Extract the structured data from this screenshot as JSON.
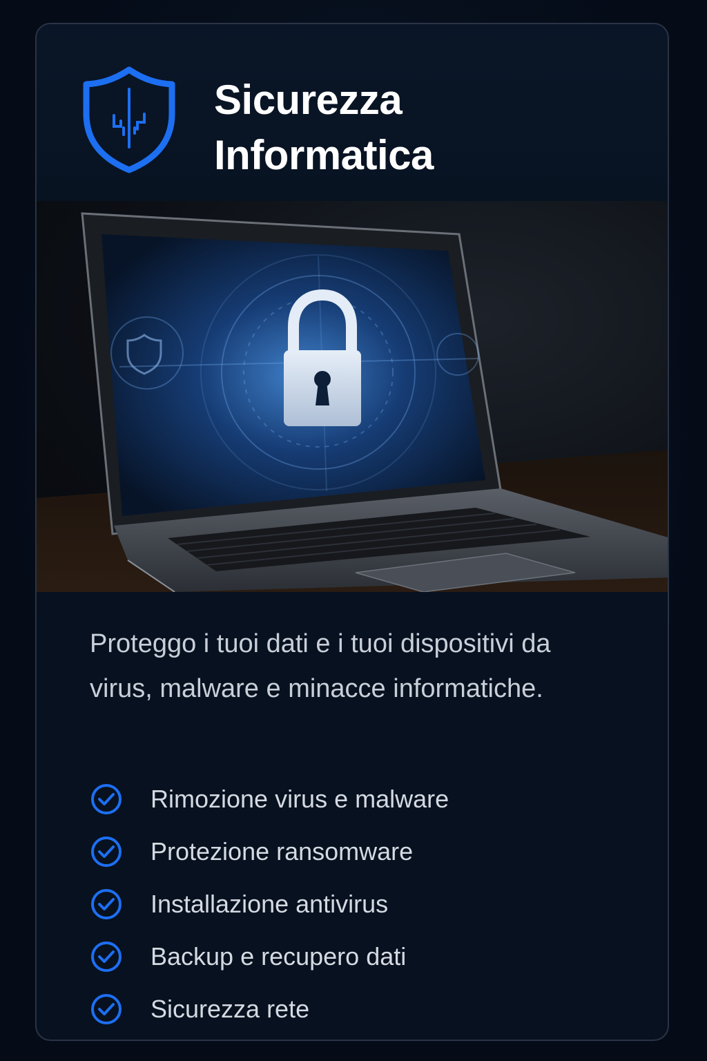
{
  "header": {
    "title_line1": "Sicurezza",
    "title_line2": "Informatica",
    "logo_icon": "shield-icon"
  },
  "hero": {
    "image": "laptop-padlock-illustration",
    "icons": [
      "laptop-icon",
      "padlock-icon"
    ]
  },
  "description": "Proteggo i tuoi dati e i tuoi dispositivi da virus, malware e minacce informatiche.",
  "features": [
    {
      "label": "Rimozione virus e malware",
      "icon": "check-circle-icon"
    },
    {
      "label": "Protezione ransomware",
      "icon": "check-circle-icon"
    },
    {
      "label": "Installazione antivirus",
      "icon": "check-circle-icon"
    },
    {
      "label": "Backup e recupero dati",
      "icon": "check-circle-icon"
    },
    {
      "label": "Sicurezza rete",
      "icon": "check-circle-icon"
    }
  ],
  "colors": {
    "accent": "#1d6ff2",
    "background": "#07111f",
    "text": "#ffffff",
    "muted_text": "#c9cfd9",
    "border": "#2a3445"
  }
}
